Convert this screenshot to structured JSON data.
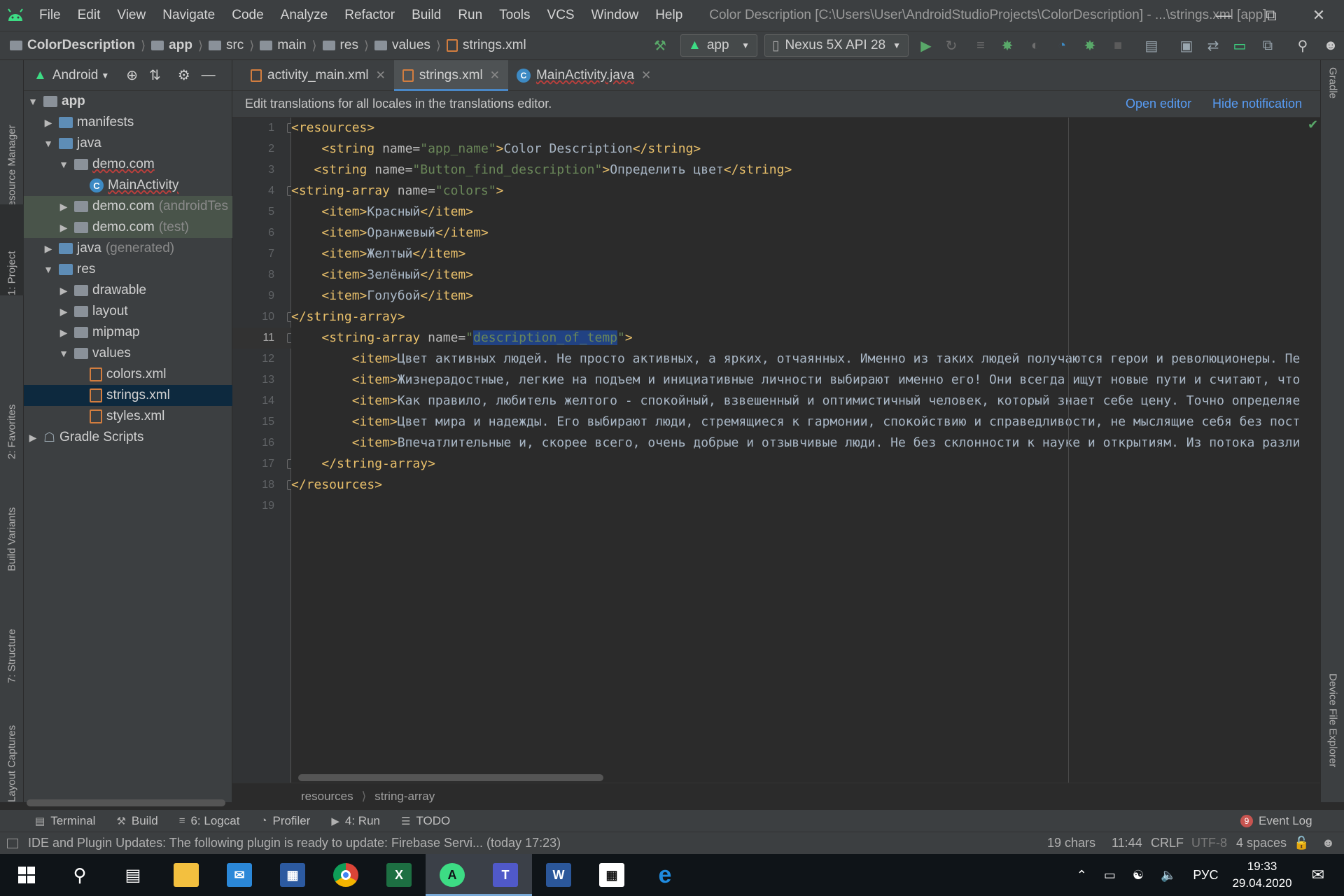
{
  "menubar": {
    "items": [
      "File",
      "Edit",
      "View",
      "Navigate",
      "Code",
      "Analyze",
      "Refactor",
      "Build",
      "Run",
      "Tools",
      "VCS",
      "Window",
      "Help"
    ],
    "title": "Color Description [C:\\Users\\User\\AndroidStudioProjects\\ColorDescription] - ...\\strings.xml [app]"
  },
  "navbar": {
    "crumbs": [
      "ColorDescription",
      "app",
      "src",
      "main",
      "res",
      "values",
      "strings.xml"
    ],
    "run_config": "app",
    "device": "Nexus 5X API 28"
  },
  "project_panel": {
    "view_mode": "Android",
    "tree": [
      {
        "label": "app",
        "extra": ""
      },
      {
        "label": "manifests",
        "extra": ""
      },
      {
        "label": "java",
        "extra": ""
      },
      {
        "label": "demo.com",
        "extra": ""
      },
      {
        "label": "MainActivity",
        "extra": ""
      },
      {
        "label": "demo.com",
        "extra": "(androidTes"
      },
      {
        "label": "demo.com",
        "extra": "(test)"
      },
      {
        "label": "java",
        "extra": "(generated)"
      },
      {
        "label": "res",
        "extra": ""
      },
      {
        "label": "drawable",
        "extra": ""
      },
      {
        "label": "layout",
        "extra": ""
      },
      {
        "label": "mipmap",
        "extra": ""
      },
      {
        "label": "values",
        "extra": ""
      },
      {
        "label": "colors.xml",
        "extra": ""
      },
      {
        "label": "strings.xml",
        "extra": ""
      },
      {
        "label": "styles.xml",
        "extra": ""
      },
      {
        "label": "Gradle Scripts",
        "extra": ""
      }
    ]
  },
  "side_tabs": {
    "left": [
      "Resource Manager",
      "1: Project",
      "2: Favorites",
      "Build Variants",
      "7: Structure",
      "Layout Captures"
    ],
    "right": [
      "Gradle",
      "Device File Explorer"
    ]
  },
  "tabs": [
    {
      "label": "activity_main.xml"
    },
    {
      "label": "strings.xml"
    },
    {
      "label": "MainActivity.java"
    }
  ],
  "notification": {
    "message": "Edit translations for all locales in the translations editor.",
    "open_editor": "Open editor",
    "hide": "Hide notification"
  },
  "editor": {
    "line_numbers": [
      "1",
      "2",
      "3",
      "4",
      "5",
      "6",
      "7",
      "8",
      "9",
      "10",
      "11",
      "12",
      "13",
      "14",
      "15",
      "16",
      "17",
      "18",
      "19"
    ],
    "lines": [
      {
        "indent": "",
        "tag_open": "<resources>",
        "attr": "",
        "val": "",
        "text": "",
        "tag_close": ""
      },
      {
        "indent": "    ",
        "tag_open": "<string ",
        "attr": "name=",
        "val": "\"app_name\"",
        "mid": ">",
        "text": "Color Description",
        "tag_close": "</string>"
      },
      {
        "indent": "   ",
        "tag_open": "<string ",
        "attr": "name=",
        "val": "\"Button_find_description\"",
        "mid": ">",
        "text": "Определить цвет",
        "tag_close": "</string>"
      },
      {
        "indent": "",
        "tag_open": "<string-array ",
        "attr": "name=",
        "val": "\"colors\"",
        "mid": ">",
        "text": "",
        "tag_close": ""
      },
      {
        "indent": "    ",
        "tag_open": "<item>",
        "attr": "",
        "val": "",
        "mid": "",
        "text": "Красный",
        "tag_close": "</item>"
      },
      {
        "indent": "    ",
        "tag_open": "<item>",
        "attr": "",
        "val": "",
        "mid": "",
        "text": "Оранжевый",
        "tag_close": "</item>"
      },
      {
        "indent": "    ",
        "tag_open": "<item>",
        "attr": "",
        "val": "",
        "mid": "",
        "text": "Желтый",
        "tag_close": "</item>"
      },
      {
        "indent": "    ",
        "tag_open": "<item>",
        "attr": "",
        "val": "",
        "mid": "",
        "text": "Зелёный",
        "tag_close": "</item>"
      },
      {
        "indent": "    ",
        "tag_open": "<item>",
        "attr": "",
        "val": "",
        "mid": "",
        "text": "Голубой",
        "tag_close": "</item>"
      },
      {
        "indent": "",
        "tag_open": "</string-array>",
        "attr": "",
        "val": "",
        "mid": "",
        "text": "",
        "tag_close": ""
      },
      {
        "indent": "    ",
        "tag_open": "<string-array ",
        "attr": "name=",
        "val": "\"",
        "sel": "description_of_temp",
        "val2": "\"",
        "mid": ">",
        "text": "",
        "tag_close": ""
      },
      {
        "indent": "        ",
        "tag_open": "<item>",
        "attr": "",
        "val": "",
        "mid": "",
        "text": "Цвет активных людей. Не просто активных, а ярких, отчаянных. Именно из таких людей получаются герои и революционеры. Пе",
        "tag_close": ""
      },
      {
        "indent": "        ",
        "tag_open": "<item>",
        "attr": "",
        "val": "",
        "mid": "",
        "text": "Жизнерадостные, легкие на подъем и инициативные личности выбирают именно его! Они всегда ищут новые пути и считают, что",
        "tag_close": ""
      },
      {
        "indent": "        ",
        "tag_open": "<item>",
        "attr": "",
        "val": "",
        "mid": "",
        "text": "Как правило, любитель желтого - спокойный, взвешенный и оптимистичный человек, который знает себе цену. Точно определяе",
        "tag_close": ""
      },
      {
        "indent": "        ",
        "tag_open": "<item>",
        "attr": "",
        "val": "",
        "mid": "",
        "text": "Цвет мира и надежды. Его выбирают люди, стремящиеся к гармонии, спокойствию и справедливости, не мыслящие себя без пост",
        "tag_close": ""
      },
      {
        "indent": "        ",
        "tag_open": "<item>",
        "attr": "",
        "val": "",
        "mid": "",
        "text": "Впечатлительные и, скорее всего, очень добрые и отзывчивые люди. Не без склонности к науке и открытиям. Из потока разли",
        "tag_close": ""
      },
      {
        "indent": "    ",
        "tag_open": "</string-array>",
        "attr": "",
        "val": "",
        "mid": "",
        "text": "",
        "tag_close": ""
      },
      {
        "indent": "",
        "tag_open": "</resources>",
        "attr": "",
        "val": "",
        "mid": "",
        "text": "",
        "tag_close": ""
      },
      {
        "indent": "",
        "tag_open": "",
        "attr": "",
        "val": "",
        "mid": "",
        "text": "",
        "tag_close": ""
      }
    ],
    "breadcrumb": [
      "resources",
      "string-array"
    ]
  },
  "bottom_tools": [
    "Terminal",
    "Build",
    "6: Logcat",
    "Profiler",
    "4: Run",
    "TODO"
  ],
  "event_log": {
    "label": "Event Log",
    "count": "9"
  },
  "statusbar": {
    "message": "IDE and Plugin Updates: The following plugin is ready to update: Firebase Servi... (today 17:23)",
    "chars": "19 chars",
    "position": "11:44",
    "line_sep": "CRLF",
    "encoding": "UTF-8",
    "indent": "4 spaces"
  },
  "taskbar": {
    "lang": "РУС",
    "time": "19:33",
    "date": "29.04.2020",
    "apps": [
      "windows-start",
      "search",
      "task-view",
      "file-explorer",
      "mail",
      "floppy-save",
      "chrome",
      "excel",
      "android-studio",
      "teams",
      "word",
      "calculator",
      "edge"
    ]
  },
  "colors": {
    "tag": "#e8bf6a",
    "attr": "#bababa",
    "value": "#6a8759",
    "text": "#a9b7c6",
    "selection": "#214283",
    "link": "#589df6",
    "run": "#59a869"
  }
}
